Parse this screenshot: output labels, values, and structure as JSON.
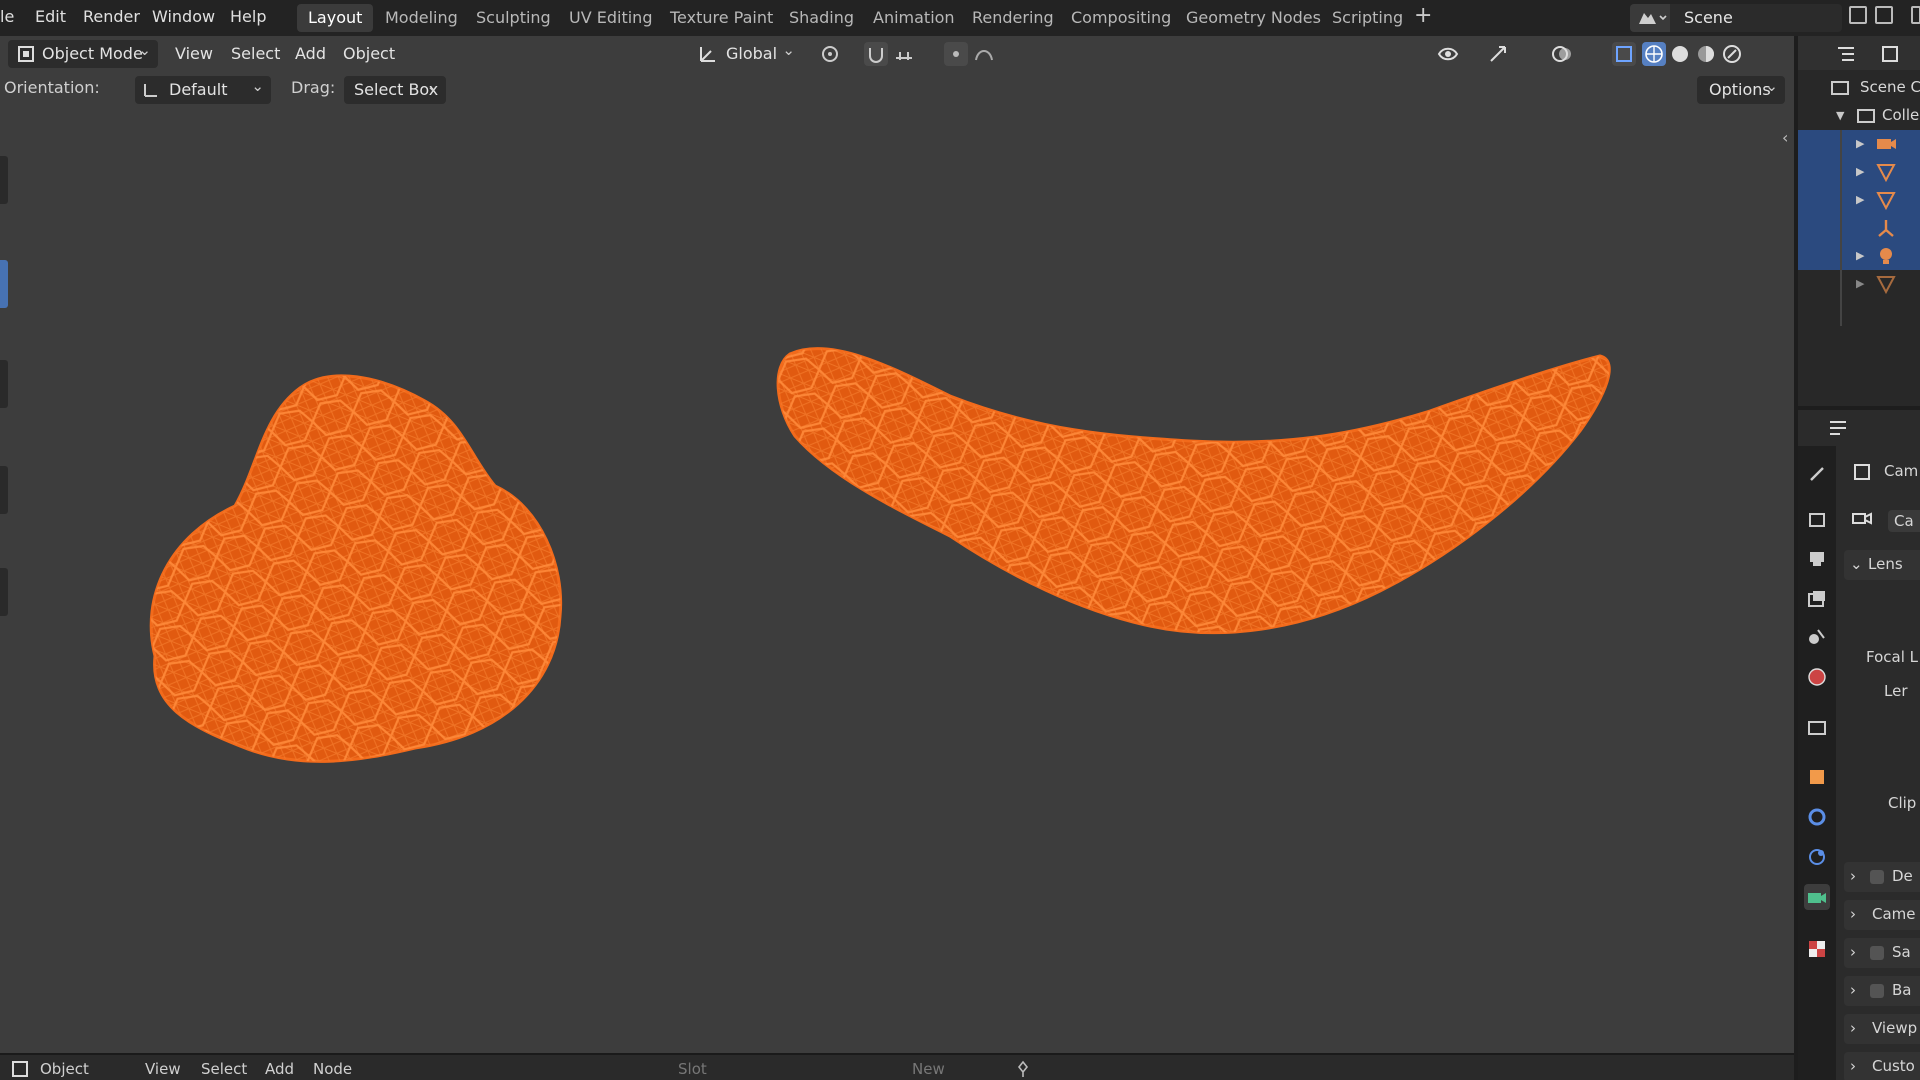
{
  "menubar": {
    "items": [
      "le",
      "Edit",
      "Render",
      "Window",
      "Help"
    ],
    "workspaces": [
      "Layout",
      "Modeling",
      "Sculpting",
      "UV Editing",
      "Texture Paint",
      "Shading",
      "Animation",
      "Rendering",
      "Compositing",
      "Geometry Nodes",
      "Scripting"
    ],
    "active_workspace": "Layout",
    "add_label": "+",
    "scene_label": "Scene"
  },
  "viewport_header": {
    "mode": "Object Mode",
    "menus": [
      "View",
      "Select",
      "Add",
      "Object"
    ],
    "transform_orientation": "Global"
  },
  "tool_header": {
    "orientation_label": "Orientation:",
    "orientation_value": "Default",
    "drag_label": "Drag:",
    "drag_value": "Select Box",
    "options_label": "Options"
  },
  "bottom_header": {
    "editor": "Object",
    "menus": [
      "View",
      "Select",
      "Add",
      "Node"
    ],
    "slot_label": "Slot",
    "new_label": "New"
  },
  "outliner": {
    "rows": [
      "Scene C",
      "Colle"
    ]
  },
  "properties": {
    "object_name": "Cam",
    "data_name": "Ca",
    "lens_panel": "Lens",
    "field_labels": [
      "Focal L",
      "Ler",
      "Clip"
    ],
    "subpanels": [
      "De",
      "Came",
      "Sa",
      "Ba",
      "Viewp",
      "Custo"
    ]
  },
  "colors": {
    "viewport_bg": "#3d3d3d",
    "wireframe": "#f26a1b",
    "selection": "#2b4a7f",
    "header_bg": "#232323"
  },
  "icons": [
    "object-mode-icon",
    "global-orientation-icon",
    "pivot-icon",
    "snap-icon",
    "proportional-icon",
    "visibility-icon",
    "gizmo-icon",
    "overlay-icon",
    "xray-icon",
    "wireframe-shading-icon",
    "solid-shading-icon",
    "material-shading-icon",
    "rendered-shading-icon",
    "camera-object-icon",
    "mesh-icon",
    "armature-icon",
    "light-icon",
    "tool-icon",
    "render-icon",
    "output-icon",
    "view-layer-icon",
    "scene-icon",
    "world-icon",
    "collection-icon",
    "object-icon",
    "modifier-icon",
    "physics-icon",
    "camera-data-icon",
    "texture-icon"
  ]
}
